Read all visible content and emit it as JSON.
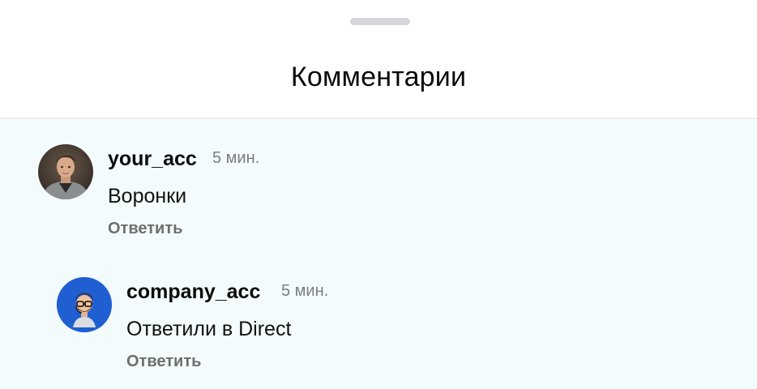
{
  "sheet": {
    "title": "Комментарии"
  },
  "comments": [
    {
      "username": "your_acc",
      "time": "5 мин.",
      "text": "Воронки",
      "reply_label": "Ответить",
      "avatar": "user-photo-avatar"
    },
    {
      "username": "company_acc",
      "time": "5 мин.",
      "text": "Ответили в Direct",
      "reply_label": "Ответить",
      "avatar": "memoji-avatar"
    }
  ],
  "colors": {
    "background": "#ffffff",
    "list_background": "#f3fbfd",
    "company_avatar_bg": "#1f5fd1",
    "secondary_text": "#7d7d7d"
  }
}
